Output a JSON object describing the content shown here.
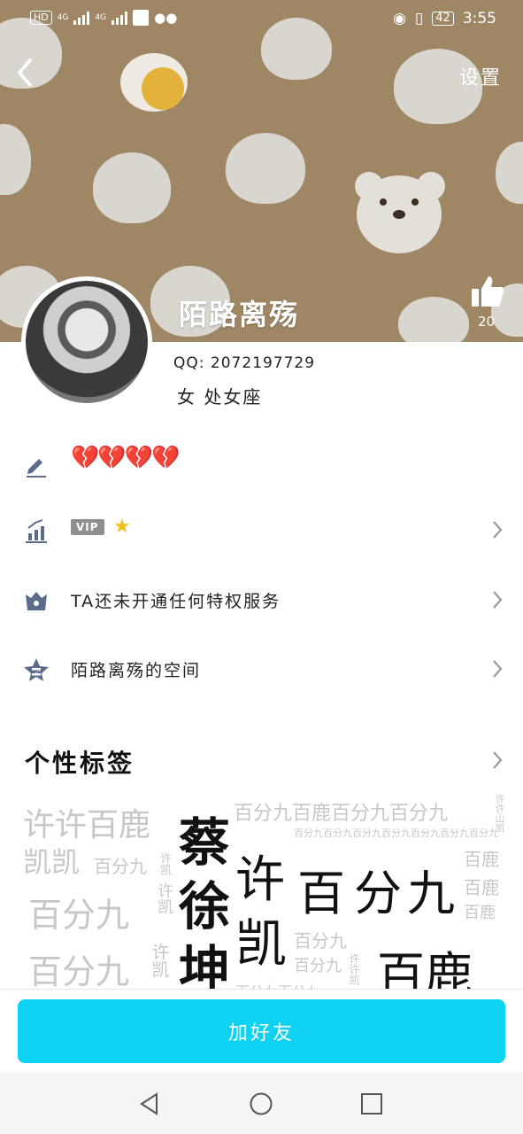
{
  "status_bar": {
    "hd": "HD",
    "net1": "4G",
    "net2": "4G",
    "battery": "42",
    "time": "3:55"
  },
  "header": {
    "settings_label": "设置",
    "nickname": "陌路离殇",
    "like_count": "20"
  },
  "profile": {
    "qq_line": "QQ: 2072197729",
    "gender_location": "女  处女座"
  },
  "rows": {
    "signature_emoji": "💔💔💔💔",
    "vip_badge": "VIP",
    "privilege_text": "TA还未开通任何特权服务",
    "space_text": "陌路离殇的空间"
  },
  "tags": {
    "title": "个性标签",
    "words": [
      "许许百鹿",
      "凯凯",
      "百分九",
      "许凯",
      "百分九",
      "许凯",
      "百分九",
      "许凯",
      "蔡",
      "徐",
      "坤",
      "百分九百鹿百分九百分九",
      "许许山凯",
      "百分九百分九百分九百分九百分九百分九百分九",
      "许",
      "百",
      "分",
      "九",
      "凯",
      "百鹿",
      "百鹿",
      "百鹿",
      "百分九",
      "百分九",
      "许许凯",
      "百鹿",
      "百分九百分九"
    ]
  },
  "footer": {
    "add_friend_label": "加好友"
  },
  "colors": {
    "cover": "#9f8766",
    "accent": "#0fd1f2"
  }
}
